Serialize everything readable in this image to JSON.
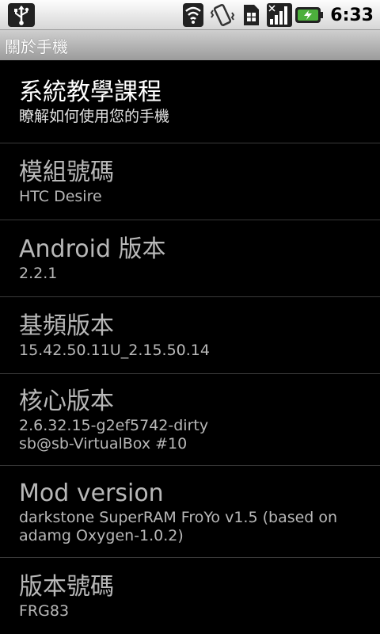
{
  "status_bar": {
    "time": "6:33",
    "icons": [
      "usb-icon",
      "wifi-icon",
      "vibrate-icon",
      "sim-icon",
      "signal-icon",
      "battery-charging-icon"
    ]
  },
  "title_bar": {
    "title": "關於手機"
  },
  "items": [
    {
      "title": "系統教學課程",
      "summary": "瞭解如何使用您的手機"
    },
    {
      "title": "模組號碼",
      "summary": "HTC Desire"
    },
    {
      "title": "Android 版本",
      "summary": "2.2.1"
    },
    {
      "title": "基頻版本",
      "summary": "15.42.50.11U_2.15.50.14"
    },
    {
      "title": "核心版本",
      "summary": "2.6.32.15-g2ef5742-dirty\nsb@sb-VirtualBox #10"
    },
    {
      "title": "Mod version",
      "summary": "darkstone SuperRAM FroYo v1.5 (based on\nadamg Oxygen-1.0.2)"
    },
    {
      "title": "版本號碼",
      "summary": "FRG83"
    }
  ],
  "colors": {
    "battery_accent": "#4caf3c",
    "background": "#000000"
  }
}
